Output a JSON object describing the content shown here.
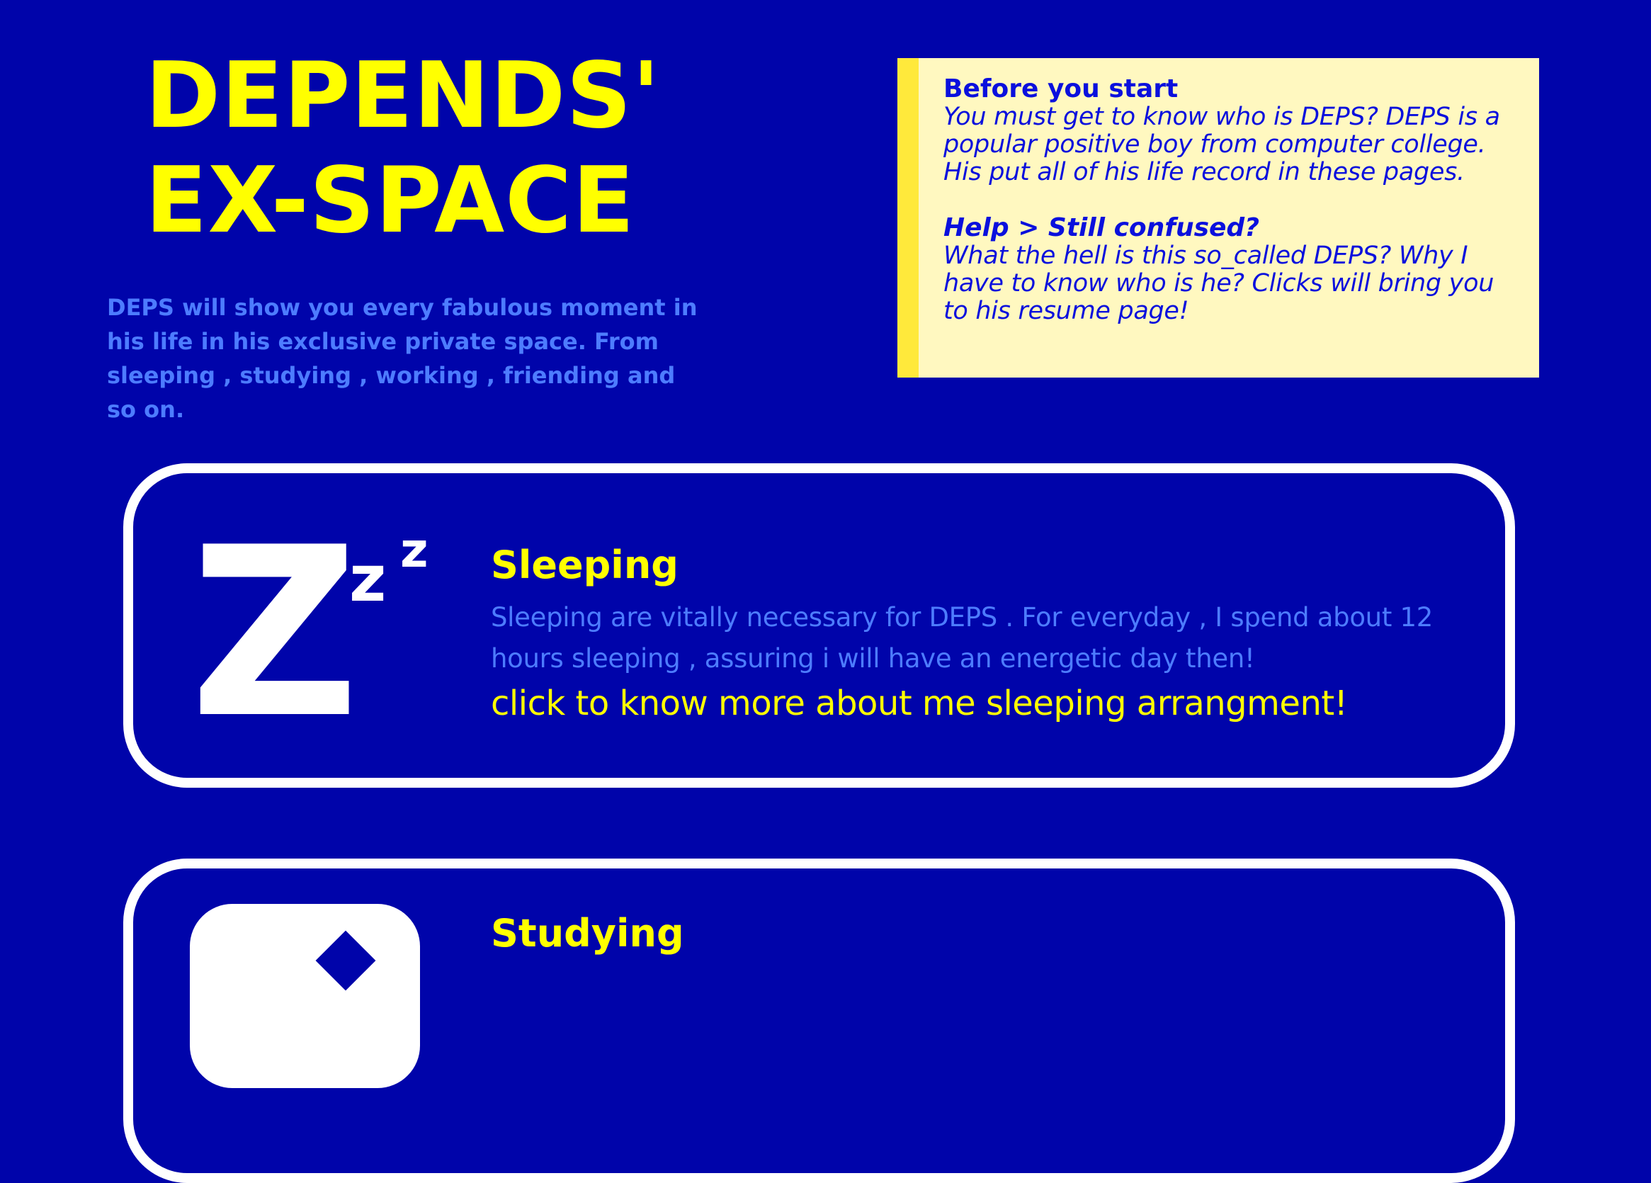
{
  "hero": {
    "title_line1": "DEPENDS'",
    "title_line2": "EX-SPACE",
    "intro": "DEPS will show you every fabulous moment in his life in his exclusive private space. From sleeping , studying , working , friending and so on."
  },
  "note": {
    "heading1": "Before you start",
    "text1": "You must get to know who is DEPS? DEPS is a popular positive boy from computer college. His put all of his life record in these pages.",
    "heading2": "Help > Still confused?",
    "text2": "What the hell is this so_called DEPS? Why I have to know who is he? Clicks will bring you to his resume page!"
  },
  "cards": [
    {
      "title": "Sleeping",
      "description": "Sleeping are vitally necessary for DEPS . For everyday , I spend about 12 hours sleeping , assuring i will have an energetic day then!",
      "link": "click to know more about me sleeping arrangment!",
      "icon": "sleep-zzz-icon"
    },
    {
      "title": "Studying",
      "icon": "study-icon"
    }
  ],
  "colors": {
    "background": "#0004aa",
    "accent": "#ffff00",
    "muted_text": "#4d7cff",
    "note_background": "#fff8c0",
    "note_border": "#ffe93b",
    "note_text": "#0a10dd"
  }
}
